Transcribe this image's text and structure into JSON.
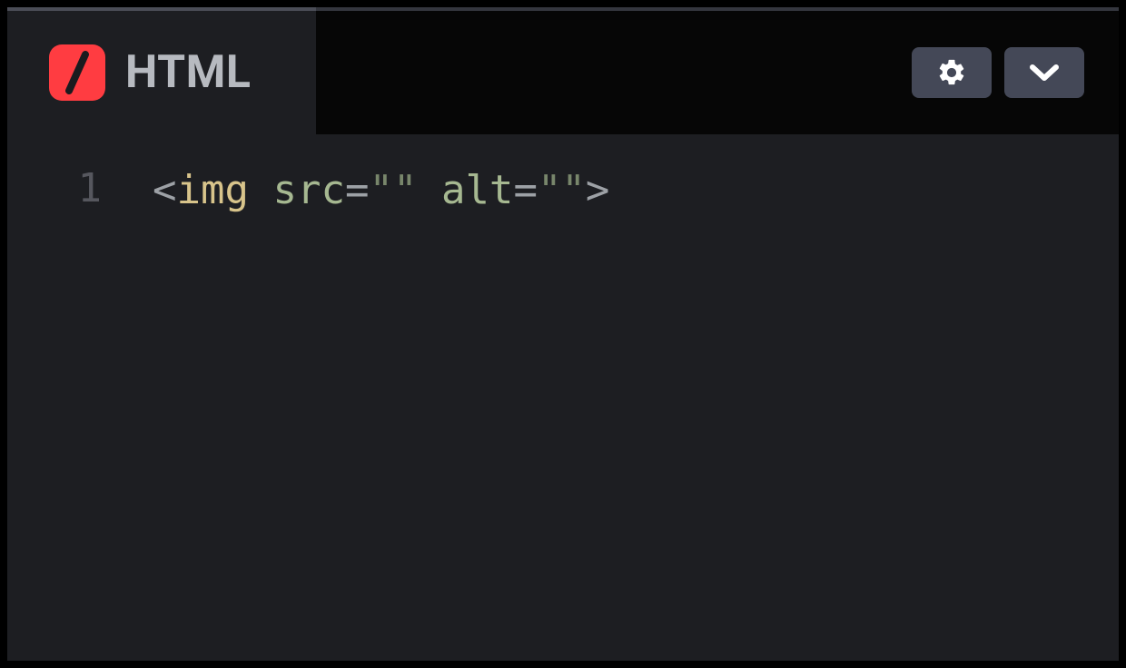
{
  "tab": {
    "title": "HTML",
    "logo_name": "html-logo",
    "logo_accent": "#ff3c41"
  },
  "actions": {
    "settings_icon": "gear-icon",
    "collapse_icon": "chevron-down-icon"
  },
  "editor": {
    "line_numbers": [
      "1"
    ],
    "lines": [
      {
        "tokens": [
          {
            "t": "<",
            "c": "bracket"
          },
          {
            "t": "img",
            "c": "tag"
          },
          {
            "t": " ",
            "c": "bracket"
          },
          {
            "t": "src",
            "c": "attr"
          },
          {
            "t": "=",
            "c": "op"
          },
          {
            "t": "\"\"",
            "c": "str"
          },
          {
            "t": " ",
            "c": "bracket"
          },
          {
            "t": "alt",
            "c": "attr"
          },
          {
            "t": "=",
            "c": "op"
          },
          {
            "t": "\"\"",
            "c": "str"
          },
          {
            "t": ">",
            "c": "bracket"
          }
        ]
      }
    ]
  }
}
